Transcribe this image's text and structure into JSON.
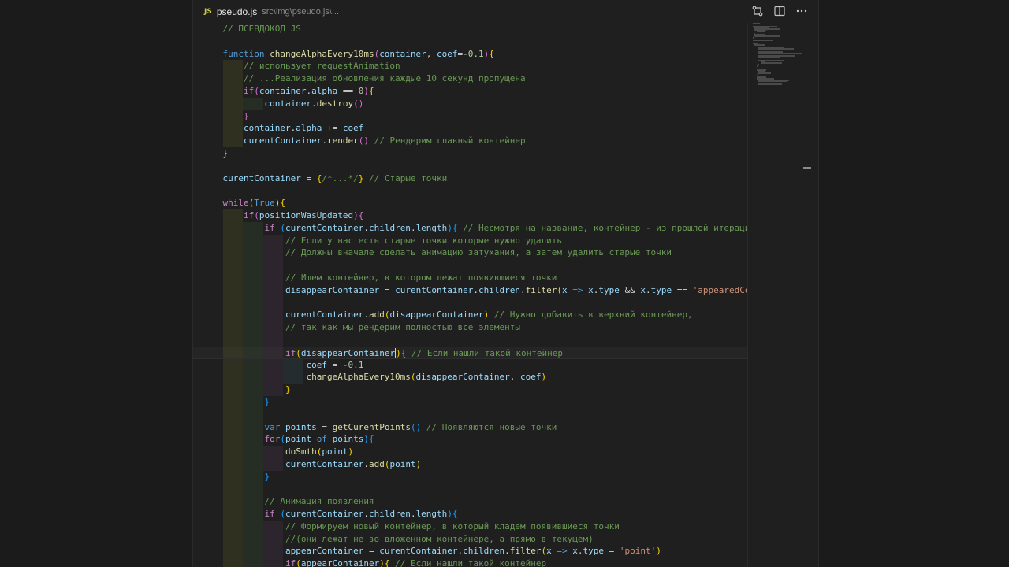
{
  "tab": {
    "icon_label": "JS",
    "filename": "pseudo.js",
    "path": "src\\img\\pseudo.js\\..."
  },
  "actions": [
    {
      "icon": "compare-changes-icon"
    },
    {
      "icon": "split-editor-icon"
    },
    {
      "icon": "more-actions-icon"
    }
  ],
  "code_lines": [
    "// ПСЕВДОКОД JS",
    "",
    "function changeAlphaEvery10ms(container, coef=-0.1){",
    "    // использует requestAnimation",
    "    // ...Реализация обновления каждые 10 секунд пропущена",
    "    if(container.alpha == 0){",
    "        container.destroy()",
    "    }",
    "    container.alpha += coef",
    "    curentContainer.render() // Рендерим главный контейнер",
    "}",
    "",
    "curentContainer = {/*...*/} // Старые точки",
    "",
    "while(True){",
    "    if(positionWasUpdated){",
    "        if (curentContainer.children.length){ // Несмотря на название, контейнер - из прошлой итерации",
    "            // Если у нас есть старые точки которые нужно удалить",
    "            // Должны вначале сделать анимацию затухания, а затем удалить старые точки",
    "",
    "            // Ищем контейнер, в котором лежат появившиеся точки",
    "            disappearContainer = curentContainer.children.filter(x => x.type && x.type == 'appearedConta",
    "",
    "            curentContainer.add(disappearContainer) // Нужно добавить в верхний контейнер,",
    "            // так как мы рендерим полностью все элементы",
    "",
    "            if(disappearContainer){ // Если нашли такой контейнер",
    "                coef = -0.1",
    "                changeAlphaEvery10ms(disappearContainer, coef)",
    "            }",
    "        }",
    "",
    "        var points = getCurentPoints() // Появляются новые точки",
    "        for(point of points){",
    "            doSmth(point)",
    "            curentContainer.add(point)",
    "        }",
    "",
    "        // Анимация появления",
    "        if (curentContainer.children.length){",
    "            // Формируем новый контейнер, в который кладем появившиеся точки",
    "            //(они лежат не во вложенном контейнере, а прямо в текущем)",
    "            appearContainer = curentContainer.children.filter(x => x.type = 'point')",
    "            if(appearContainer){ // Если нашли такой контейнер"
  ],
  "colors": {
    "keyword": "#569cd6",
    "control": "#c586c0",
    "function": "#dcdcaa",
    "variable": "#9cdcfe",
    "comment": "#6a9955",
    "number": "#b5cea8",
    "string": "#ce9178"
  }
}
